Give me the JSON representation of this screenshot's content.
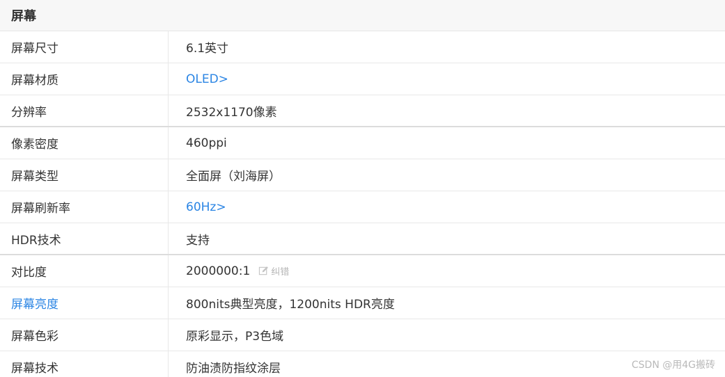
{
  "section": {
    "title": "屏幕"
  },
  "rows": [
    {
      "label": "屏幕尺寸",
      "value": "6.1英寸"
    },
    {
      "label": "屏幕材质",
      "value": "OLED>"
    },
    {
      "label": "分辨率",
      "value": "2532x1170像素"
    },
    {
      "label": "像素密度",
      "value": "460ppi"
    },
    {
      "label": "屏幕类型",
      "value": "全面屏（刘海屏）"
    },
    {
      "label": "屏幕刷新率",
      "value": "60Hz>"
    },
    {
      "label": "HDR技术",
      "value": "支持"
    },
    {
      "label": "对比度",
      "value": "2000000:1",
      "correction": "纠错"
    },
    {
      "label": "屏幕亮度",
      "value": "800nits典型亮度，1200nits HDR亮度"
    },
    {
      "label": "屏幕色彩",
      "value": "原彩显示，P3色域"
    },
    {
      "label": "屏幕技术",
      "value": "防油渍防指纹涂层"
    }
  ],
  "watermark": "CSDN @用4G搬砖",
  "colors": {
    "link": "#2b85e4",
    "header_bg": "#f7f7f7",
    "text": "#333333",
    "muted": "#b5b5b5"
  }
}
